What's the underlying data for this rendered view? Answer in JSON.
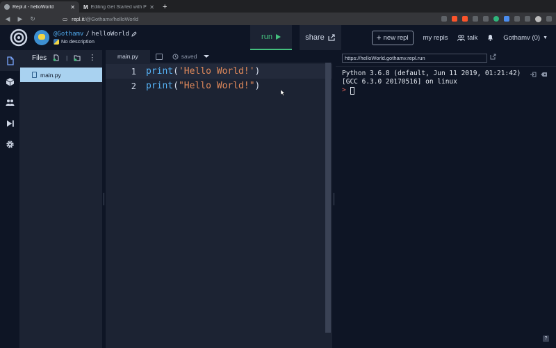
{
  "browser": {
    "tabs": [
      {
        "title": "Repl.it - helloWorld",
        "active": true
      },
      {
        "title": "Editing Get Started with Python",
        "active": false,
        "favicon_letter": "M"
      }
    ],
    "url": {
      "host": "repl.it",
      "path": "/@Gothamv/helloWorld"
    }
  },
  "header": {
    "username": "@Gothamv",
    "separator": "/",
    "repl_name": "helloWorld",
    "description": "No description",
    "run_label": "run",
    "share_label": "share",
    "new_repl_label": "new repl",
    "my_repls_label": "my repls",
    "talk_label": "talk",
    "account_label": "Gothamv (0)"
  },
  "files": {
    "title": "Files",
    "items": [
      {
        "name": "main.py",
        "selected": true
      }
    ]
  },
  "editor": {
    "tab_label": "main.py",
    "status": "saved",
    "lines": [
      {
        "num": "1",
        "fn": "print",
        "open": "(",
        "str": "'Hello World!'",
        "close": ")"
      },
      {
        "num": "2",
        "fn": "print",
        "open": "(",
        "str": "\"Hello World!\"",
        "close": ")"
      }
    ]
  },
  "console": {
    "url": "https://helloWorld.gothamv.repl.run",
    "output": [
      "Python 3.6.8 (default, Jun 11 2019, 01:21:42)",
      "[GCC 6.3.0 20170516] on linux"
    ],
    "prompt": ">"
  },
  "help_label": "?",
  "colors": {
    "background": "#0e1525",
    "panel": "#1c2333",
    "run_green": "#44c07e",
    "keyword_blue": "#56b2f5",
    "string_orange": "#e0895b",
    "selected_file": "#a9d2f0"
  }
}
